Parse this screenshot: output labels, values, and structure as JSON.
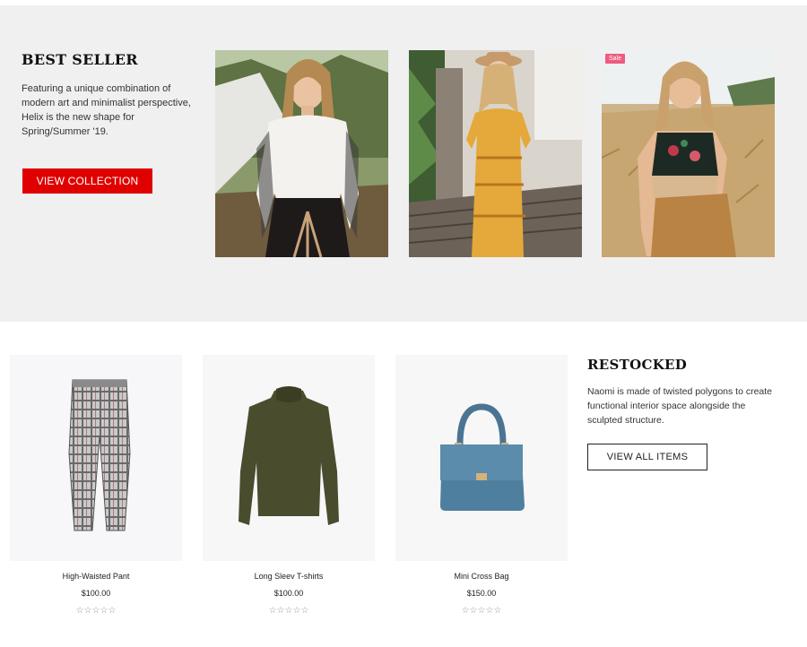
{
  "best_seller": {
    "title": "BEST SELLER",
    "description": "Featuring a unique combination of modern art and minimalist perspective, Helix is the new shape for Spring/Summer '19.",
    "button_label": "VIEW COLLECTION",
    "photos": [
      {
        "icon": "model-white-blouse-photo"
      },
      {
        "icon": "model-yellow-dress-photo"
      },
      {
        "icon": "model-embroidered-top-photo",
        "badge": "Sale"
      }
    ]
  },
  "restocked": {
    "title": "RESTOCKED",
    "description": "Naomi is made of twisted polygons to create functional interior space alongside the sculpted structure.",
    "button_label": "VIEW ALL ITEMS"
  },
  "products": [
    {
      "name": "High-Waisted Pant",
      "price": "$100.00",
      "stars": "☆☆☆☆☆",
      "icon": "plaid-pants-image"
    },
    {
      "name": "Long Sleev T-shirts",
      "price": "$100.00",
      "stars": "☆☆☆☆☆",
      "icon": "olive-sweater-image"
    },
    {
      "name": "Mini Cross Bag",
      "price": "$150.00",
      "stars": "☆☆☆☆☆",
      "icon": "blue-handbag-image"
    }
  ],
  "colors": {
    "accent_red": "#e00000",
    "section_bg": "#f0f0f0",
    "sale_badge": "#f05a7e"
  }
}
